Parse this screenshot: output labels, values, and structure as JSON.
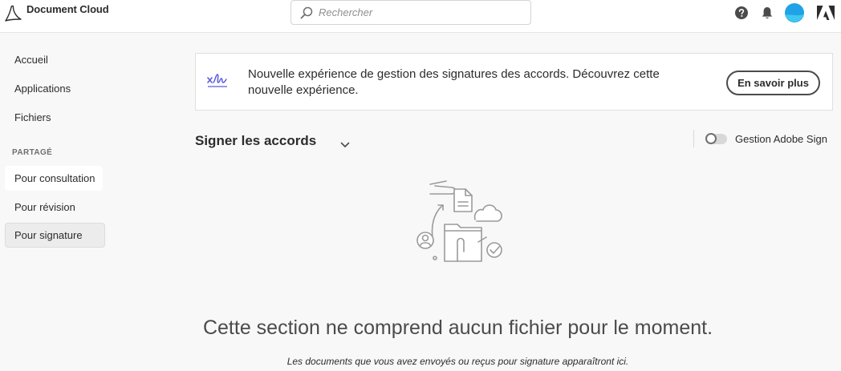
{
  "app": {
    "name": "Document Cloud"
  },
  "search": {
    "placeholder": "Rechercher"
  },
  "header_icons": [
    "help-icon",
    "bell-icon",
    "avatar",
    "adobe-logo-icon"
  ],
  "sidebar": {
    "items": [
      {
        "label": "Accueil"
      },
      {
        "label": "Applications"
      },
      {
        "label": "Fichiers"
      }
    ],
    "section_label": "PARTAGÉ",
    "shared_items": [
      {
        "label": "Pour consultation"
      },
      {
        "label": "Pour révision"
      },
      {
        "label": "Pour signature"
      }
    ]
  },
  "banner": {
    "text": "Nouvelle expérience de gestion des signatures des accords. Découvrez cette nouvelle expérience.",
    "button_label": "En savoir plus"
  },
  "main": {
    "title": "Signer les accords",
    "toggle_label": "Gestion Adobe Sign",
    "toggle_on": false,
    "empty_title": "Cette section ne comprend aucun fichier pour le moment.",
    "empty_subtitle": "Les documents que vous avez envoyés ou reçus pour signature apparaîtront ici."
  },
  "colors": {
    "background": "#f8f8f8",
    "panel": "#ffffff",
    "accent_signature": "#5c5ce0",
    "avatar": "#1fa3e6",
    "text": "#2c2c2c"
  }
}
